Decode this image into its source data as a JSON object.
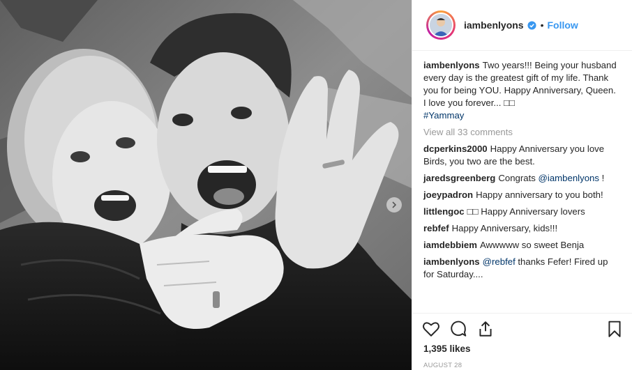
{
  "post": {
    "author": "iambenlyons",
    "follow_label": "Follow",
    "separator": "•",
    "caption": {
      "user": "iambenlyons",
      "text": "Two years!!! Being your husband every day is the greatest gift of my life. Thank you for being YOU. Happy Anniversary, Queen. I love you forever... □□",
      "hashtag": "#Yammay"
    },
    "view_all_comments": "View all 33 comments",
    "comments": [
      {
        "user": "dcperkins2000",
        "text": "Happy Anniversary you love Birds, you two are the best."
      },
      {
        "user": "jaredsgreenberg",
        "text_before": "Congrats ",
        "mention": "@iambenlyons",
        "text_after": " !"
      },
      {
        "user": "joeypadron",
        "text": "Happy anniversary to you both!"
      },
      {
        "user": "littlengoc",
        "text": "□□ Happy Anniversary lovers"
      },
      {
        "user": "rebfef",
        "text": "Happy Anniversary, kids!!!"
      },
      {
        "user": "iamdebbiem",
        "text": "Awwwww so sweet Benja"
      },
      {
        "user": "iambenlyons",
        "mention": "@rebfef",
        "text_after": " thanks Fefer! Fired up for Saturday...."
      }
    ],
    "likes": "1,395 likes",
    "date": "AUGUST 28",
    "icons": {
      "like": "heart-icon",
      "comment": "comment-icon",
      "share": "share-icon",
      "save": "bookmark-icon",
      "verified": "verified-badge-icon",
      "carousel": "chevron-right-icon"
    },
    "colors": {
      "link": "#003569",
      "follow": "#3897f0",
      "verified": "#3897f0",
      "muted": "#999999"
    }
  }
}
